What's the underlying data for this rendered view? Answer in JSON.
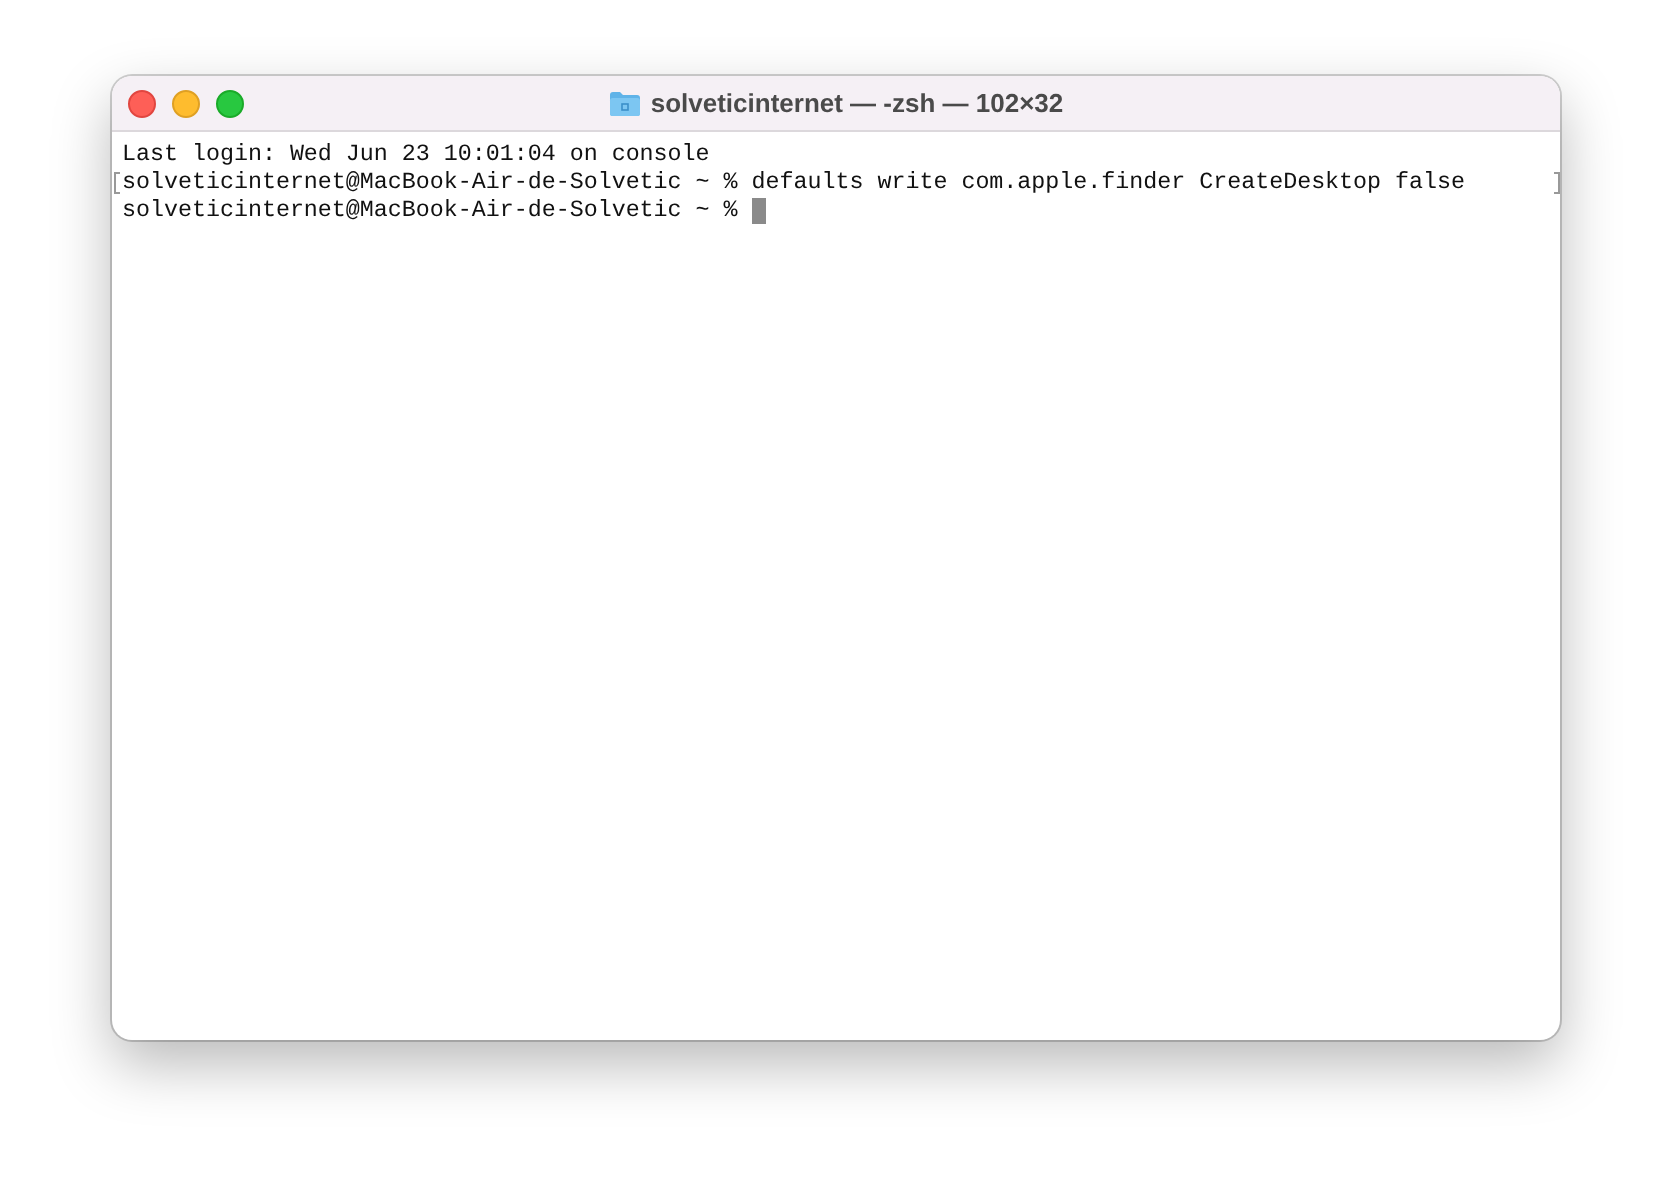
{
  "window": {
    "title": "solveticinternet — -zsh — 102×32"
  },
  "terminal": {
    "lines": [
      {
        "text": "Last login: Wed Jun 23 10:01:04 on console",
        "marked": false,
        "cursor": false
      },
      {
        "text": "solveticinternet@MacBook-Air-de-Solvetic ~ % defaults write com.apple.finder CreateDesktop false",
        "marked": true,
        "cursor": false
      },
      {
        "text": "solveticinternet@MacBook-Air-de-Solvetic ~ % ",
        "marked": false,
        "cursor": true
      }
    ]
  }
}
